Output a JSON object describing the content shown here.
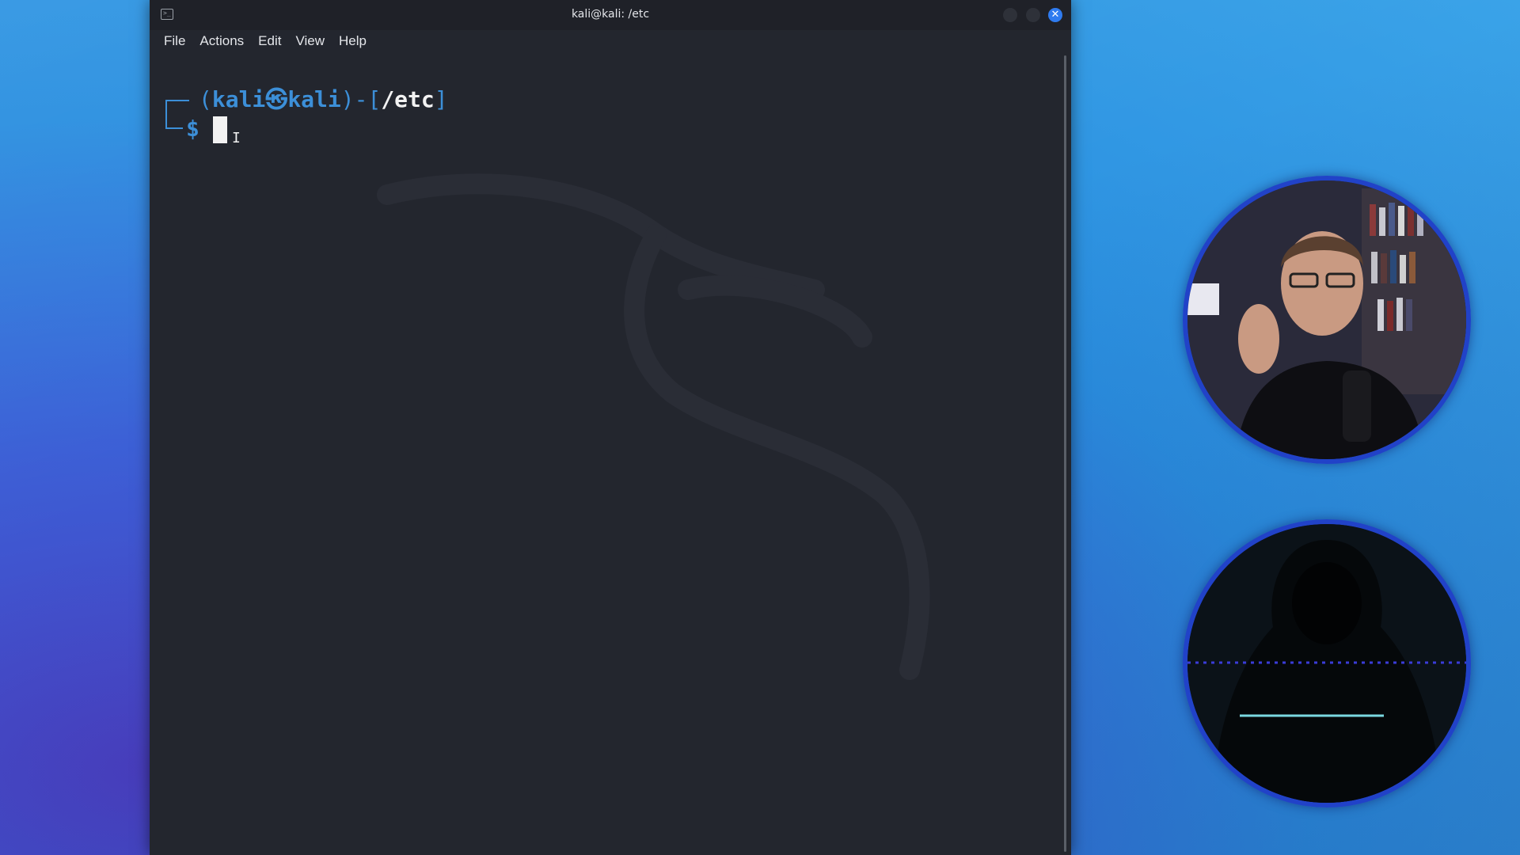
{
  "window": {
    "title": "kali@kali: /etc"
  },
  "menu": [
    "File",
    "Actions",
    "Edit",
    "View",
    "Help"
  ],
  "prompt": {
    "open_paren": "(",
    "user": "kali",
    "at_symbol": "㉿",
    "host": "kali",
    "close_paren": ")",
    "separator": "-",
    "open_bracket": "[",
    "path": "/etc",
    "close_bracket": "]",
    "symbol": "$"
  },
  "colors": {
    "prompt_blue": "#3c8fd8",
    "close_button": "#2f7bf0",
    "cam_border": "#2142c8"
  },
  "overlays": {
    "host_cam": "presenter-webcam",
    "hacker_cam": "hooded-figure-image"
  }
}
